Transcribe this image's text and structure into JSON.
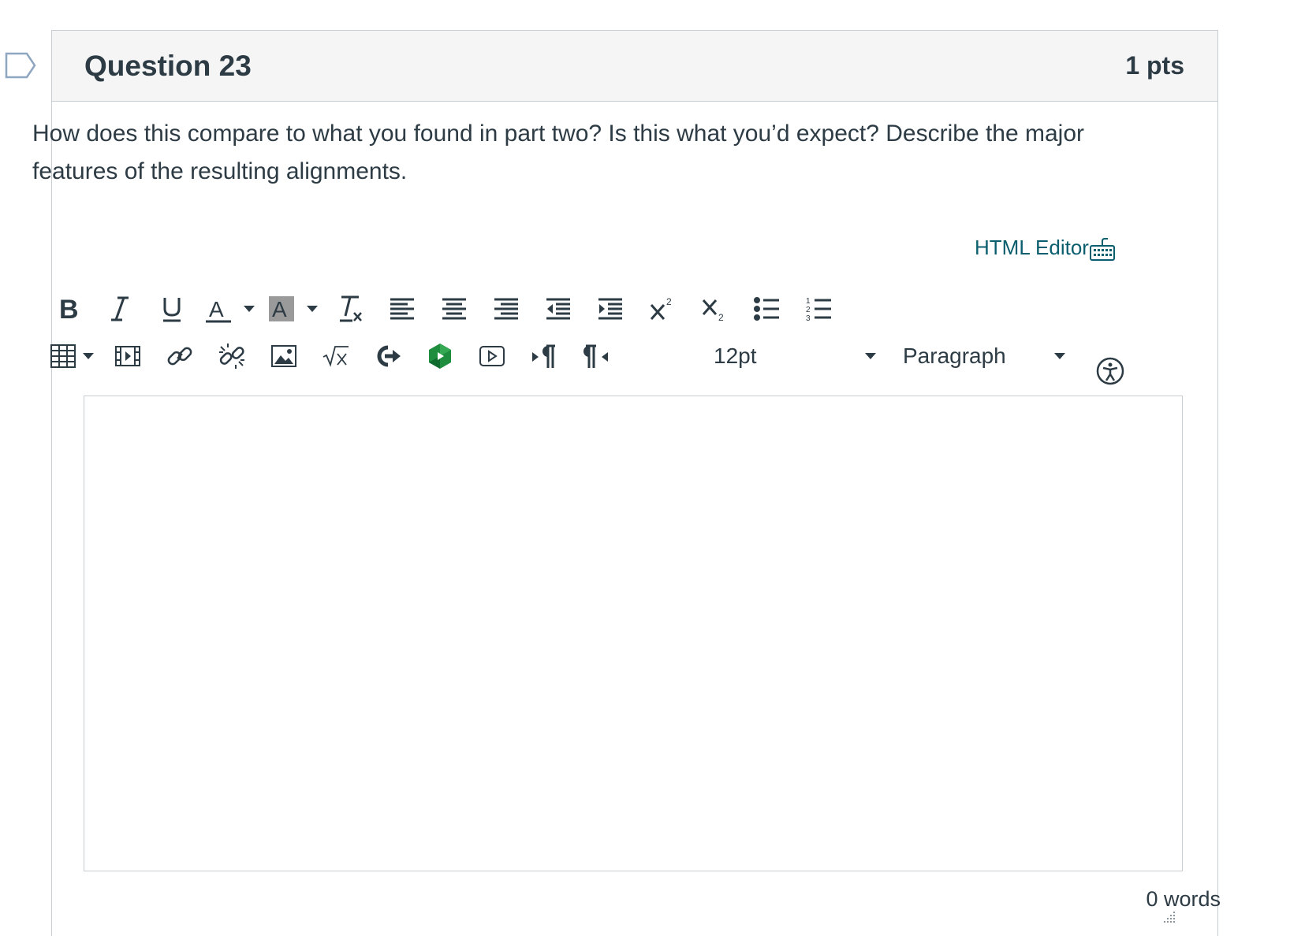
{
  "question": {
    "title": "Question 23",
    "points": "1 pts",
    "text": "How does this compare to what you found in part two? Is this what you’d expect? Describe the major features of the resulting alignments."
  },
  "editor": {
    "html_editor_label": "HTML Editor",
    "font_size": "12pt",
    "block_format": "Paragraph",
    "word_count": "0 words",
    "content": ""
  },
  "toolbar": {
    "row1": [
      "bold-icon",
      "italic-icon",
      "underline-icon",
      "text-color-icon",
      "background-color-icon",
      "clear-formatting-icon",
      "align-left-icon",
      "align-center-icon",
      "align-right-icon",
      "outdent-icon",
      "indent-icon",
      "superscript-icon",
      "subscript-icon",
      "bulleted-list-icon",
      "numbered-list-icon"
    ],
    "row2": [
      "table-icon",
      "media-icon",
      "link-icon",
      "unlink-icon",
      "image-icon",
      "equation-icon",
      "lti-tool-icon",
      "google-drive-icon",
      "embed-video-icon",
      "ltr-paragraph-icon",
      "rtl-paragraph-icon",
      "accessibility-icon"
    ]
  },
  "colors": {
    "text": "#2d3b45",
    "link": "#0b5e6e",
    "header_bg": "#f5f5f5",
    "border": "#c7cdd1",
    "google_drive": "#1e8e3e"
  }
}
